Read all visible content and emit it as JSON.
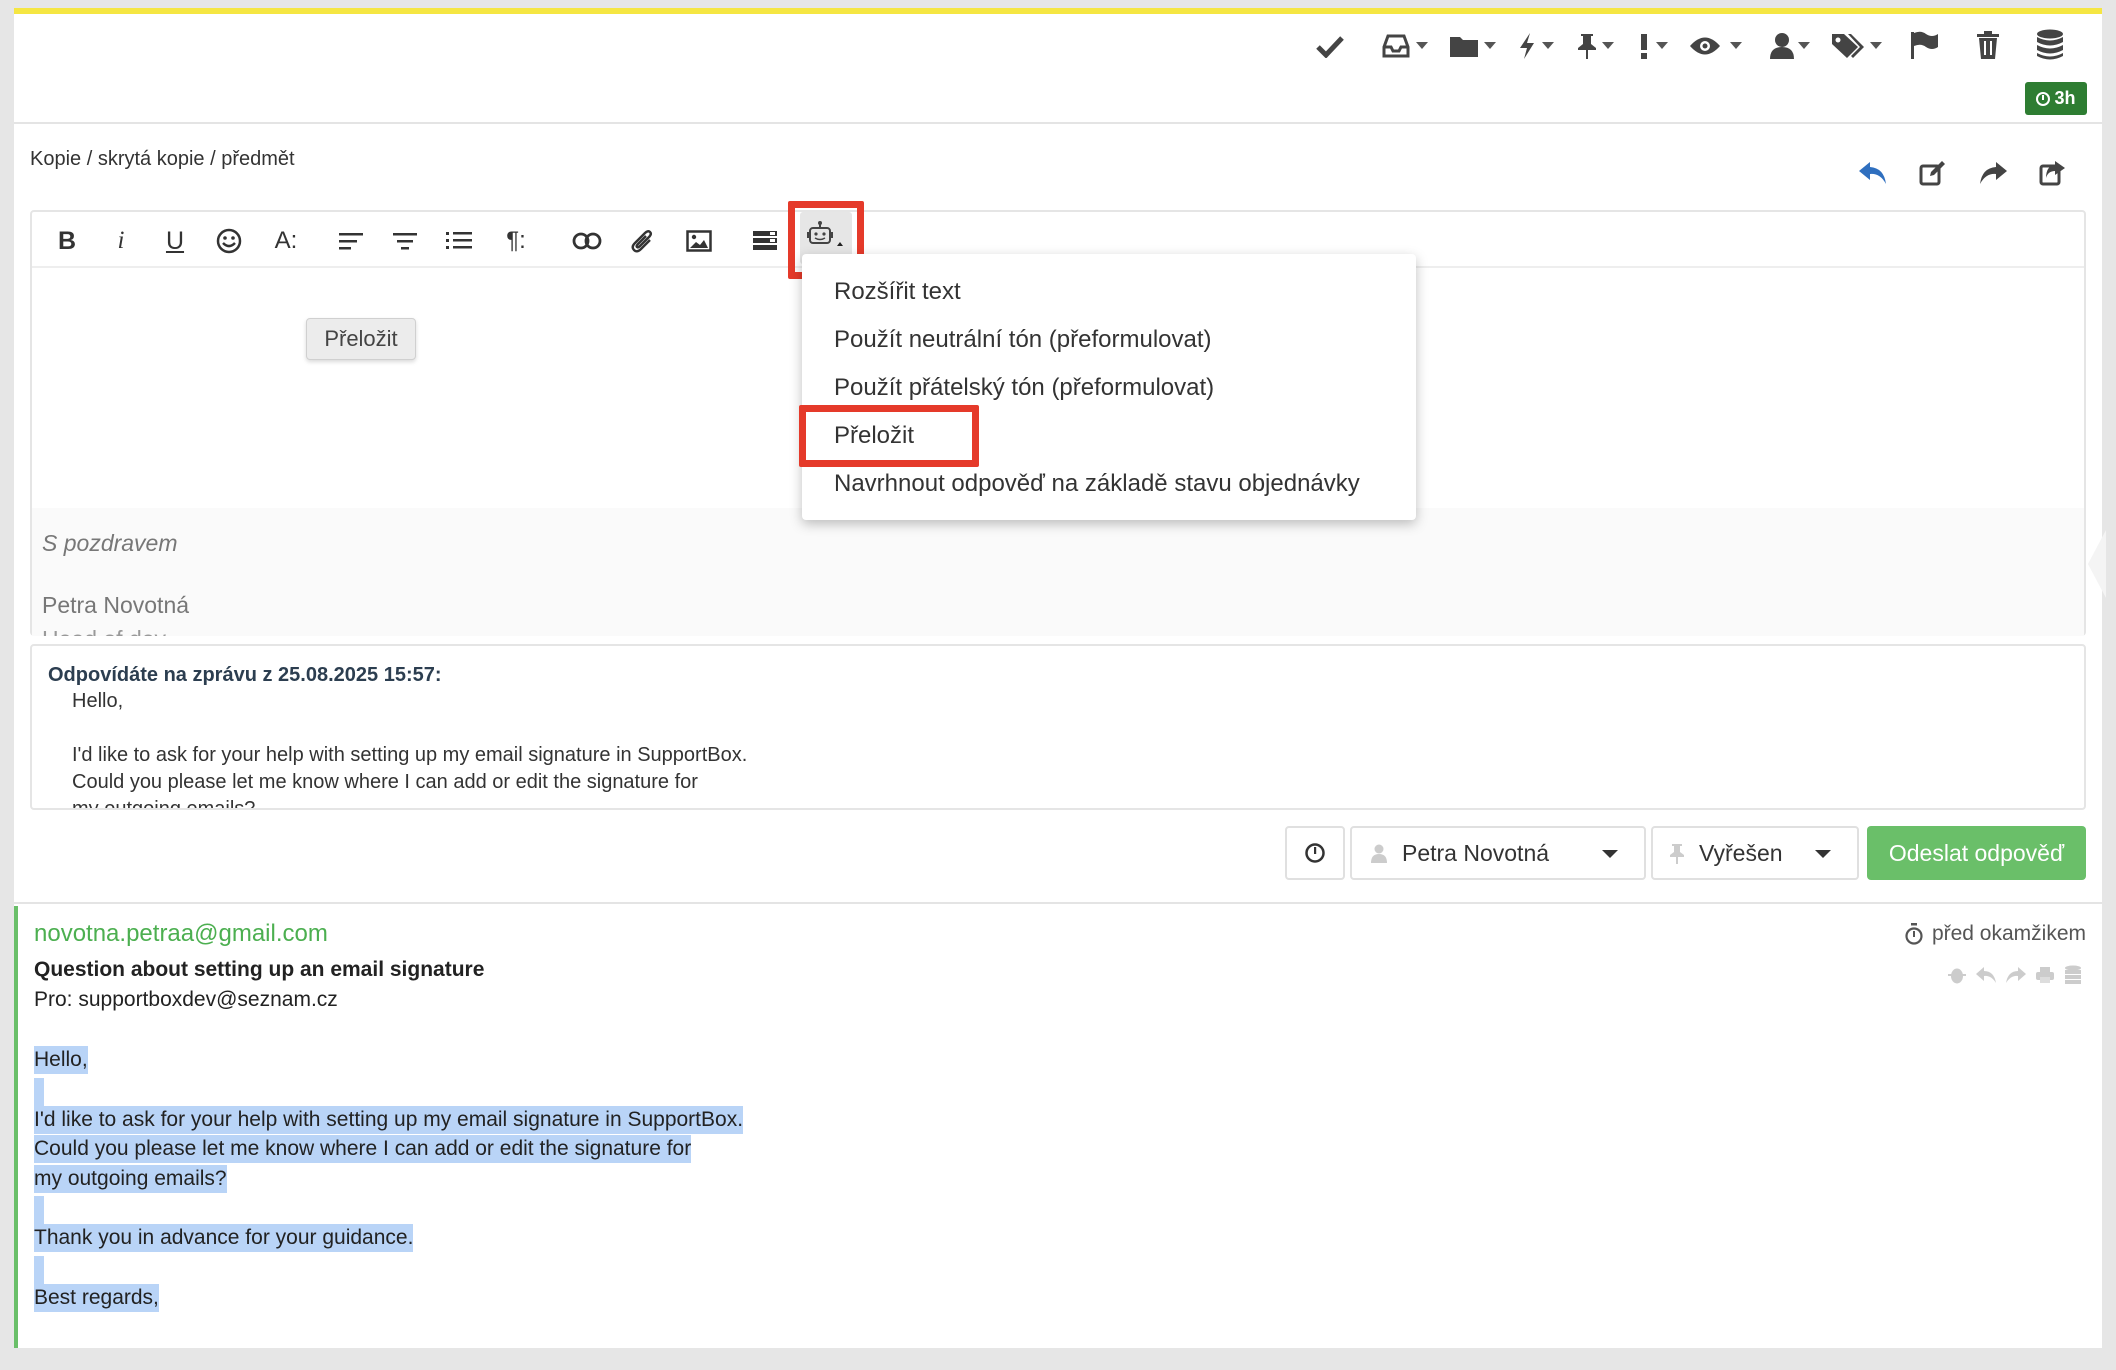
{
  "top_toolbar": {
    "icons": [
      "check-icon",
      "inbox-icon",
      "folder-icon",
      "bolt-icon",
      "pin-icon",
      "exclamation-icon",
      "eye-icon",
      "user-icon",
      "tags-icon",
      "flag-icon",
      "trash-icon",
      "database-icon"
    ],
    "timer_badge": "3h"
  },
  "reply": {
    "recipients_label": "Kopie / skrytá kopie / předmět",
    "actions": [
      "reply-icon",
      "edit-icon",
      "forward-icon",
      "share-icon"
    ]
  },
  "editor": {
    "toolbar": {
      "bold": "B",
      "italic": "i",
      "underline": "U",
      "font_size": "A:",
      "paragraph": "¶:"
    },
    "tooltip": "Přeložit",
    "signature": {
      "greeting": "S pozdravem",
      "name": "Petra Novotná",
      "title": "Head of dev"
    }
  },
  "ai_menu": {
    "items": [
      "Rozšířit text",
      "Použít neutrální tón (přeformulovat)",
      "Použít přátelský tón (přeformulovat)",
      "Přeložit",
      "Navrhnout odpověď na základě stavu objednávky"
    ],
    "highlighted": "Přeložit"
  },
  "quoted": {
    "header": "Odpovídáte na zprávu z 25.08.2025 15:57:",
    "lines": [
      "Hello,",
      "I'd like to ask for your help with setting up my email signature in SupportBox.",
      "Could you please let me know where I can add or edit the signature for",
      "my outgoing emails?"
    ]
  },
  "controls": {
    "assignee": "Petra Novotná",
    "status": "Vyřešen",
    "send": "Odeslat odpověď"
  },
  "message": {
    "from": "novotna.petraa@gmail.com",
    "time": "před okamžikem",
    "subject": "Question about setting up an email signature",
    "to": "Pro: supportboxdev@seznam.cz",
    "body": {
      "l1": "Hello,",
      "l2": "I'd like to ask for your help with setting up my email signature in SupportBox.",
      "l3": "Could you please let me know where I can add or edit the signature for",
      "l4": "my outgoing emails?",
      "l5": "Thank you in advance for your guidance.",
      "l6": "Best regards,"
    }
  },
  "colors": {
    "accent_yellow": "#f5e642",
    "highlight_red": "#e53a2a",
    "send_green": "#6abf69",
    "badge_green": "#2e7d32",
    "selection_blue": "#b9d4f7",
    "reply_blue": "#2f6fbf"
  }
}
